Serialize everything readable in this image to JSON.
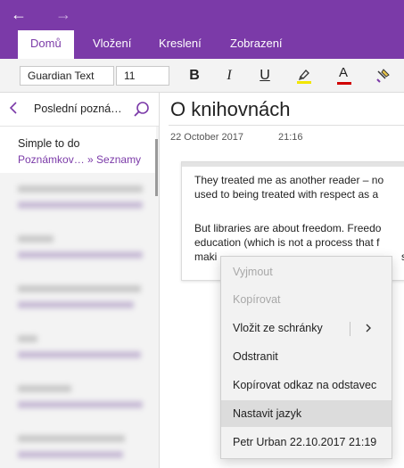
{
  "titlebar": {
    "back_icon": "←",
    "forward_icon": "→"
  },
  "ribbon": {
    "tabs": [
      {
        "label": "Domů",
        "active": true
      },
      {
        "label": "Vložení",
        "active": false
      },
      {
        "label": "Kreslení",
        "active": false
      },
      {
        "label": "Zobrazení",
        "active": false
      }
    ]
  },
  "toolbar": {
    "font_name": "Guardian Text",
    "font_size": "11",
    "bold": "B",
    "italic": "I",
    "underline": "U",
    "font_color_glyph": "A",
    "highlight_color": "#f2e600",
    "font_color": "#d00000"
  },
  "sidebar": {
    "title": "Poslední pozná…",
    "selected_item": {
      "title": "Simple to do",
      "location": "Poznámkov… » Seznamy"
    }
  },
  "page": {
    "title": "O knihovnách",
    "date": "22 October 2017",
    "time": "21:16",
    "paragraphs": [
      {
        "lines": [
          "They treated me as another reader – no",
          "used to being treated with respect as a"
        ]
      },
      {
        "lines": [
          "But libraries are about freedom. Freedo",
          "education (which is not a process that f",
          "maki",
          "s t"
        ]
      }
    ]
  },
  "context_menu": {
    "items": [
      {
        "label": "Vyjmout",
        "disabled": true
      },
      {
        "label": "Kopírovat",
        "disabled": true
      },
      {
        "label": "Vložit ze schránky",
        "has_submenu": true
      },
      {
        "label": "Odstranit"
      },
      {
        "label": "Kopírovat odkaz na odstavec"
      },
      {
        "label": "Nastavit jazyk",
        "hover": true
      },
      {
        "label": "Petr Urban 22.10.2017 21:19"
      }
    ]
  },
  "colors": {
    "accent": "#7b3aa8"
  }
}
